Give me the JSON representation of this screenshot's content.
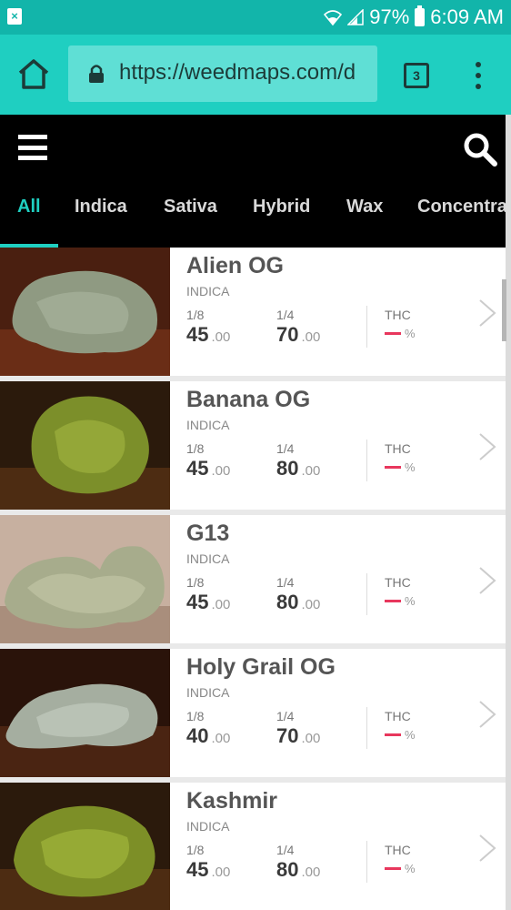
{
  "status_bar": {
    "notification_icon": "close-box-icon",
    "battery_percent": "97%",
    "time": "6:09 AM"
  },
  "browser": {
    "url": "https://weedmaps.com/d",
    "tab_count": "3"
  },
  "colors": {
    "accent": "#1fcfc1",
    "status_bar": "#12b5aa",
    "header_bg": "#000000",
    "thc_dash": "#e8375d"
  },
  "categories": [
    {
      "label": "All",
      "active": true
    },
    {
      "label": "Indica"
    },
    {
      "label": "Sativa"
    },
    {
      "label": "Hybrid"
    },
    {
      "label": "Wax"
    },
    {
      "label": "Concentrates"
    }
  ],
  "products": [
    {
      "name": "Alien OG",
      "type": "INDICA",
      "price_eighth_label": "1/8",
      "price_eighth": "45",
      "price_quarter_label": "1/4",
      "price_quarter": "70",
      "cents": ".00",
      "thc_label": "THC",
      "thc_unit": "%"
    },
    {
      "name": "Banana OG",
      "type": "INDICA",
      "price_eighth_label": "1/8",
      "price_eighth": "45",
      "price_quarter_label": "1/4",
      "price_quarter": "80",
      "cents": ".00",
      "thc_label": "THC",
      "thc_unit": "%"
    },
    {
      "name": "G13",
      "type": "INDICA",
      "price_eighth_label": "1/8",
      "price_eighth": "45",
      "price_quarter_label": "1/4",
      "price_quarter": "80",
      "cents": ".00",
      "thc_label": "THC",
      "thc_unit": "%"
    },
    {
      "name": "Holy Grail OG",
      "type": "INDICA",
      "price_eighth_label": "1/8",
      "price_eighth": "40",
      "price_quarter_label": "1/4",
      "price_quarter": "70",
      "cents": ".00",
      "thc_label": "THC",
      "thc_unit": "%"
    },
    {
      "name": "Kashmir",
      "type": "INDICA",
      "price_eighth_label": "1/8",
      "price_eighth": "45",
      "price_quarter_label": "1/4",
      "price_quarter": "80",
      "cents": ".00",
      "thc_label": "THC",
      "thc_unit": "%"
    }
  ]
}
